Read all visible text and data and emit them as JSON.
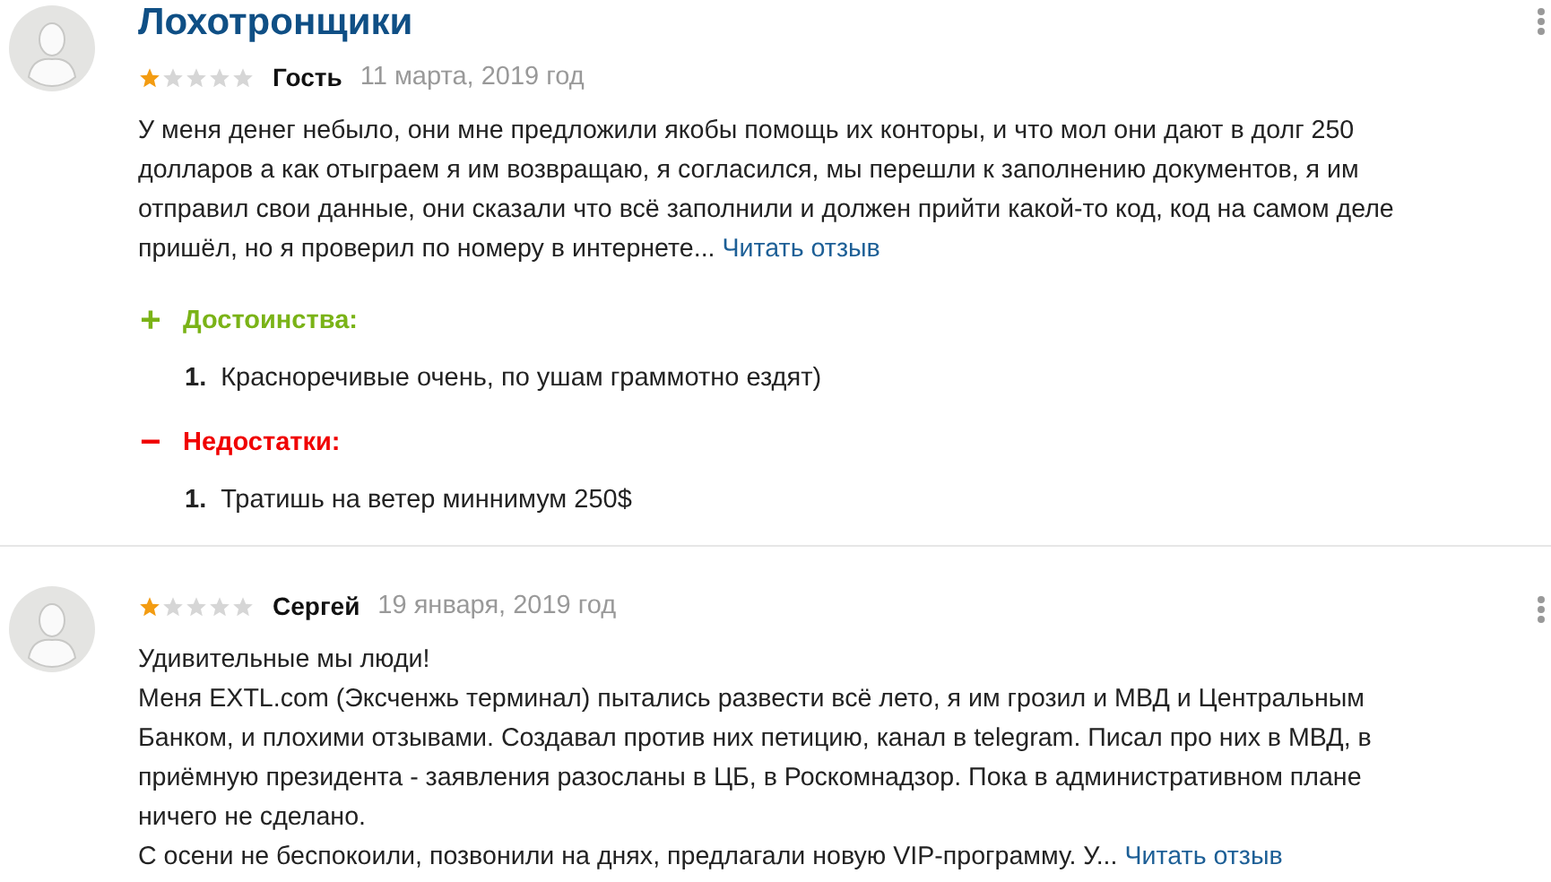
{
  "reviews": [
    {
      "title": "Лохотронщики",
      "stars": 1,
      "author": "Гость",
      "date": "11 марта, 2019 год",
      "body_lines": [
        "У меня денег небыло, они мне предложили якобы помощь их конторы, и что мол они дают в долг 250",
        "долларов а как отыграем я им возвращаю, я согласился, мы перешли к заполнению документов, я им",
        "отправил свои данные, они сказали что всё заполнили и должен прийти какой-то код, код на самом деле",
        "пришёл, но я проверил по номеру в интернете..."
      ],
      "read_more": "Читать отзыв",
      "sections": [
        {
          "kind": "pros",
          "sign": "+",
          "heading": "Достоинства:",
          "items": [
            {
              "number": "1.",
              "text": "Красноречивые очень, по ушам граммотно ездят)"
            }
          ]
        },
        {
          "kind": "cons",
          "sign": "−",
          "heading": "Недостатки:",
          "items": [
            {
              "number": "1.",
              "text": "Тратишь на ветер миннимум 250$"
            }
          ]
        }
      ]
    },
    {
      "stars": 1,
      "author": "Сергей",
      "date": "19 января, 2019 год",
      "body_lines": [
        "Удивительные мы люди!",
        "Меня EXTL.com (Эксченжь терминал) пытались развести всё лето, я им грозил и МВД и Центральным",
        "Банком, и плохими отзывами. Создавал против них петицию, канал в telegram. Писал про них в МВД, в",
        "приёмную президента - заявления разосланы в ЦБ, в Роскомнадзор. Пока в административном плане",
        "ничего не сделано.",
        "С осени не беспокоили, позвонили на днях, предлагали новую VIP-программу. У..."
      ],
      "read_more": "Читать отзыв"
    }
  ]
}
